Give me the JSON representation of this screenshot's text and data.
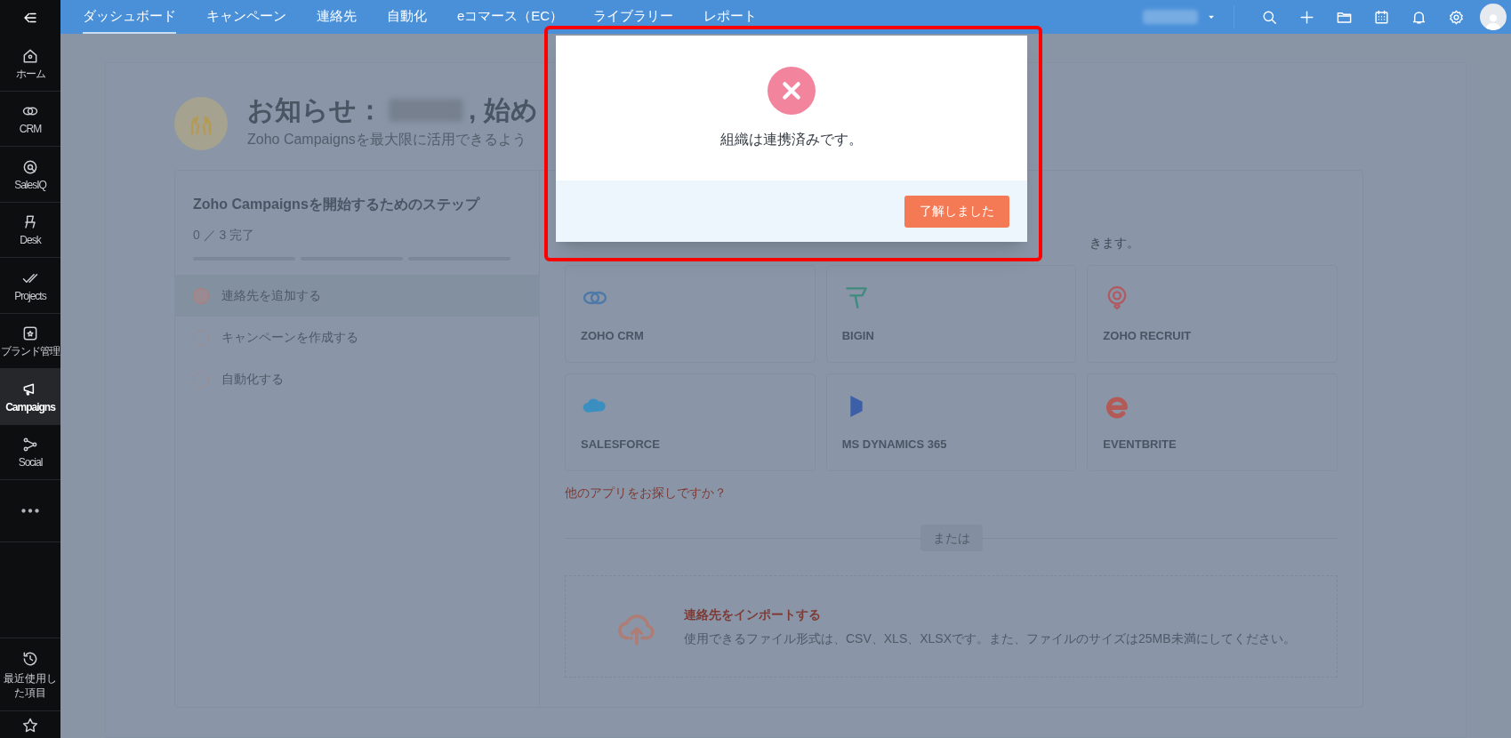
{
  "sidebar": {
    "items": [
      {
        "kind": "home",
        "label": "ホーム",
        "selected": false
      },
      {
        "kind": "crm",
        "label": "CRM",
        "selected": false
      },
      {
        "kind": "salesiq",
        "label": "SalesIQ",
        "selected": false
      },
      {
        "kind": "desk",
        "label": "Desk",
        "selected": false
      },
      {
        "kind": "projects",
        "label": "Projects",
        "selected": false
      },
      {
        "kind": "brand",
        "label": "ブランド管理",
        "selected": false
      },
      {
        "kind": "campaigns",
        "label": "Campaigns",
        "selected": true
      },
      {
        "kind": "social",
        "label": "Social",
        "selected": false
      }
    ],
    "recent": "最近使用した項目"
  },
  "topbar": {
    "tabs": [
      {
        "label": "ダッシュボード",
        "selected": true
      },
      {
        "label": "キャンペーン",
        "selected": false
      },
      {
        "label": "連絡先",
        "selected": false
      },
      {
        "label": "自動化",
        "selected": false
      },
      {
        "label": "eコマース（EC）",
        "selected": false
      },
      {
        "label": "ライブラリー",
        "selected": false
      },
      {
        "label": "レポート",
        "selected": false
      }
    ]
  },
  "page": {
    "heading_prefix": "お知らせ：",
    "heading_suffix": ", 始め",
    "subtitle": "Zoho Campaignsを最大限に活用できるよう",
    "steps_card": {
      "title": "Zoho Campaignsを開始するためのステップ",
      "progress": "0 ／ 3 完了",
      "steps": [
        {
          "label": "連絡先を追加する",
          "selected": true
        },
        {
          "label": "キャンペーンを作成する",
          "selected": false
        },
        {
          "label": "自動化する",
          "selected": false
        }
      ]
    },
    "integrations": {
      "caption": "きます。",
      "apps": [
        {
          "kind": "crm",
          "name": "ZOHO CRM"
        },
        {
          "kind": "bigin",
          "name": "BIGIN"
        },
        {
          "kind": "recruit",
          "name": "ZOHO RECRUIT"
        },
        {
          "kind": "salesforce",
          "name": "SALESFORCE"
        },
        {
          "kind": "dynamics",
          "name": "MS DYNAMICS 365"
        },
        {
          "kind": "eventbrite",
          "name": "EVENTBRITE"
        }
      ],
      "more_link": "他のアプリをお探しですか？",
      "divider": "または",
      "import": {
        "title": "連絡先をインポートする",
        "description": "使用できるファイル形式は、CSV、XLS、XLSXです。また、ファイルのサイズは25MB未満にしてください。"
      }
    }
  },
  "dialog": {
    "message": "組織は連携済みです。",
    "button": "了解しました"
  }
}
